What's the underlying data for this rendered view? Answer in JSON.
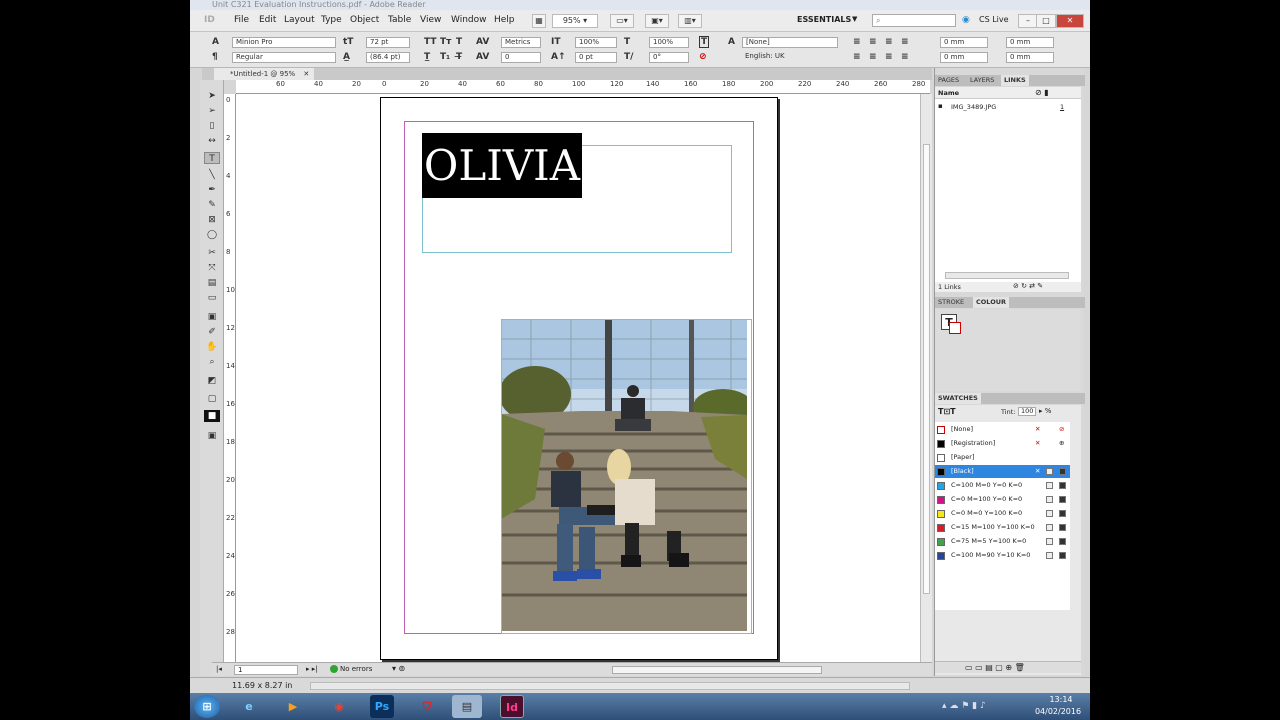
{
  "screen": {
    "bg_window_title": "Unit C321 Evaluation Instructions.pdf - Adobe Reader"
  },
  "app": {
    "logo": "ID",
    "zoom": "95%",
    "workspace": "ESSENTIALS",
    "cs_live": "CS Live"
  },
  "menu": [
    "File",
    "Edit",
    "Layout",
    "Type",
    "Object",
    "Table",
    "View",
    "Window",
    "Help"
  ],
  "control": {
    "font_family": "Minion Pro",
    "font_style": "Regular",
    "font_size": "72 pt",
    "leading": "(86.4 pt)",
    "kerning": "Metrics",
    "tracking": "0",
    "vertical_scale": "100%",
    "baseline_shift": "0 pt",
    "horizontal_scale": "100%",
    "skew": "0°",
    "character_style": "[None]",
    "language": "English: UK",
    "left_indent": "0 mm",
    "first_line_indent": "0 mm",
    "right_indent": "0 mm",
    "last_line_indent": "0 mm"
  },
  "document": {
    "tab_title": "*Untitled-1 @ 95%",
    "headline": "OLIVIA"
  },
  "ruler": {
    "h": [
      "60",
      "40",
      "20",
      "0",
      "20",
      "40",
      "60",
      "80",
      "100",
      "120",
      "140",
      "160",
      "180",
      "200",
      "220",
      "240",
      "260",
      "280"
    ],
    "v": [
      "0",
      "2",
      "4",
      "6",
      "8",
      "10",
      "12",
      "14",
      "16",
      "18",
      "20",
      "22",
      "24",
      "26",
      "28"
    ]
  },
  "status": {
    "page": "1",
    "preflight": "No errors",
    "page_size": "11.69 x 8.27 in"
  },
  "panels": {
    "pages_tab": "PAGES",
    "layers_tab": "LAYERS",
    "links_tab": "LINKS",
    "links_header": "Name",
    "links": [
      {
        "name": "IMG_3489.JPG",
        "page": "1"
      }
    ],
    "links_count": "1 Links",
    "stroke_tab": "STROKE",
    "colour_tab": "COLOUR",
    "swatches_tab": "SWATCHES",
    "tint_label": "Tint:",
    "tint_value": "100",
    "swatches": [
      {
        "name": "[None]",
        "color": "#ffffff"
      },
      {
        "name": "[Registration]",
        "color": "#000000"
      },
      {
        "name": "[Paper]",
        "color": "#ffffff"
      },
      {
        "name": "[Black]",
        "color": "#000000"
      },
      {
        "name": "C=100 M=0 Y=0 K=0",
        "color": "#23a5e6"
      },
      {
        "name": "C=0 M=100 Y=0 K=0",
        "color": "#d0128b"
      },
      {
        "name": "C=0 M=0 Y=100 K=0",
        "color": "#f4e81b"
      },
      {
        "name": "C=15 M=100 Y=100 K=0",
        "color": "#d61f2b"
      },
      {
        "name": "C=75 M=5 Y=100 K=0",
        "color": "#3fa34a"
      },
      {
        "name": "C=100 M=90 Y=10 K=0",
        "color": "#27449a"
      }
    ]
  },
  "taskbar": {
    "time": "13:14",
    "date": "04/02/2016"
  }
}
